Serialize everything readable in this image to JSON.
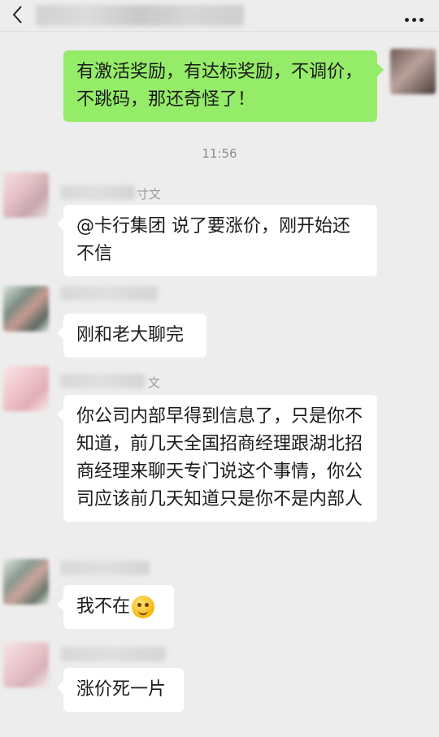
{
  "header": {
    "back_icon": "chevron-left-icon",
    "more_icon": "more-dots-icon"
  },
  "messages": [
    {
      "side": "out",
      "text": "有激活奖励，有达标奖励，不调价，不跳码，那还奇怪了！"
    },
    {
      "side": "time",
      "text": "11:56"
    },
    {
      "side": "in",
      "sender_fragment": "寸文",
      "text": "@卡行集团  说了要涨价，刚开始还不信"
    },
    {
      "side": "in",
      "text": "刚和老大聊完"
    },
    {
      "side": "in",
      "sender_fragment": "文",
      "text": "你公司内部早得到信息了，只是你不知道，前几天全国招商经理跟湖北招商经理来聊天专门说这个事情，你公司应该前几天知道只是你不是内部人"
    },
    {
      "side": "in",
      "text": "我不在",
      "emoji": "wink-tongue-emoji"
    },
    {
      "side": "in",
      "text": "涨价死一片"
    }
  ],
  "colors": {
    "background": "#ededed",
    "outgoing_bubble": "#95ec69",
    "incoming_bubble": "#ffffff"
  }
}
